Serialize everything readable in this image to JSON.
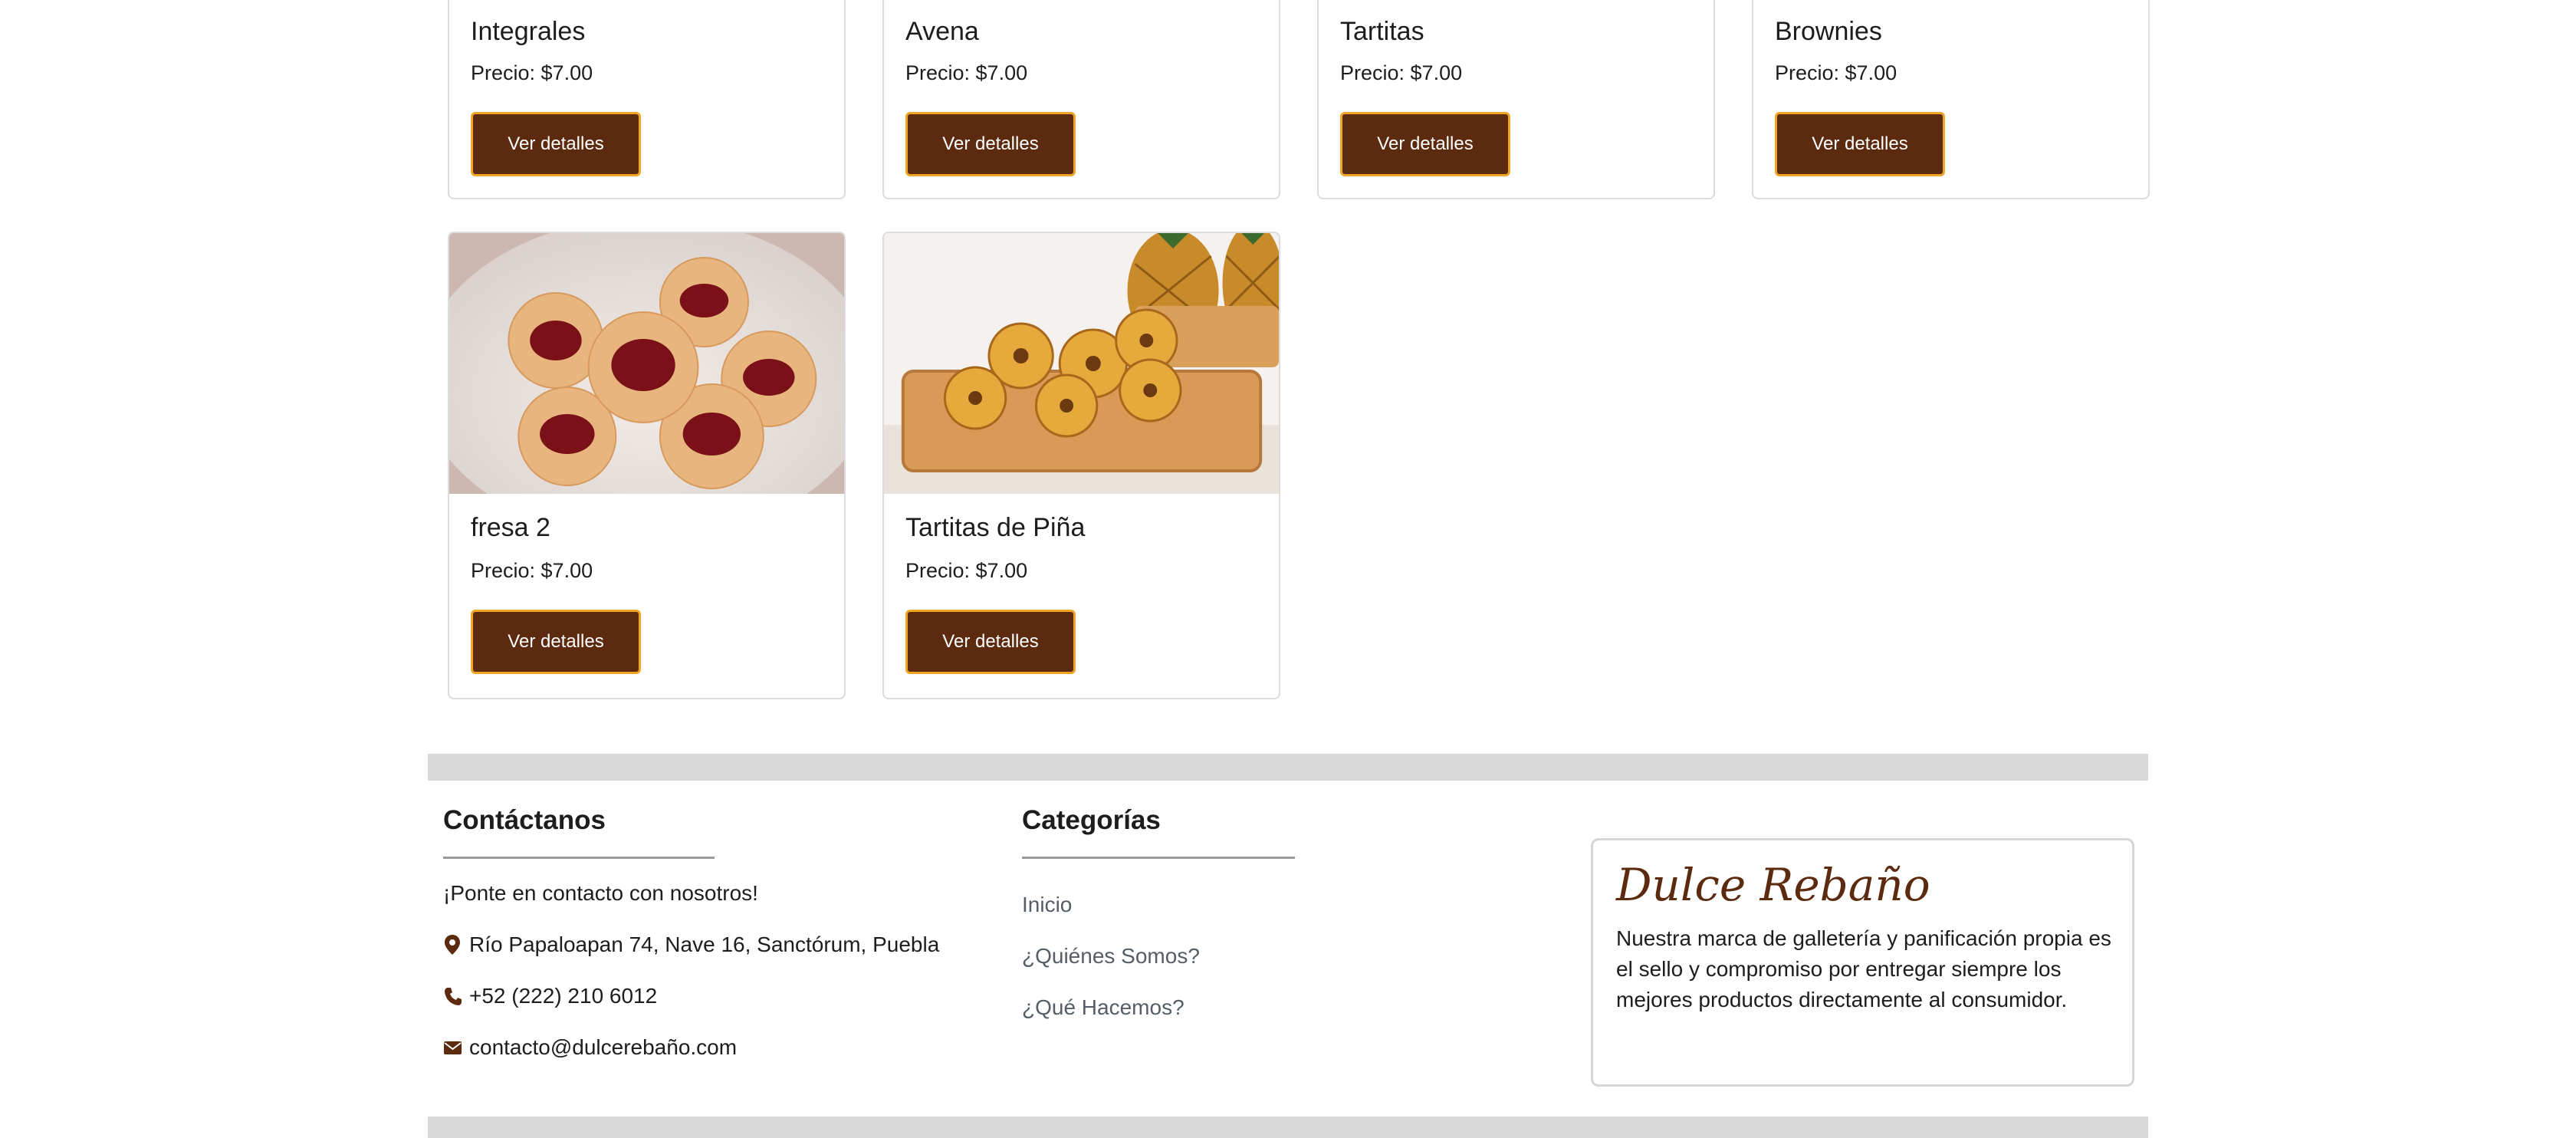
{
  "products": [
    {
      "name": "Integrales",
      "price": "Precio: $7.00",
      "button": "Ver detalles"
    },
    {
      "name": "Avena",
      "price": "Precio: $7.00",
      "button": "Ver detalles"
    },
    {
      "name": "Tartitas",
      "price": "Precio: $7.00",
      "button": "Ver detalles"
    },
    {
      "name": "Brownies",
      "price": "Precio: $7.00",
      "button": "Ver detalles"
    },
    {
      "name": "fresa 2",
      "price": "Precio: $7.00",
      "button": "Ver detalles"
    },
    {
      "name": "Tartitas de Piña",
      "price": "Precio: $7.00",
      "button": "Ver detalles"
    }
  ],
  "footer": {
    "contact": {
      "heading": "Contáctanos",
      "intro": "¡Ponte en contacto con nosotros!",
      "address": "Río Papaloapan 74, Nave 16, Sanctórum, Puebla",
      "phone": "+52 (222) 210 6012",
      "email": "contacto@dulcerebaño.com"
    },
    "categories": {
      "heading": "Categorías",
      "links": [
        "Inicio",
        "¿Quiénes Somos?",
        "¿Qué Hacemos?"
      ]
    },
    "brand": {
      "name": "Dulce Rebaño",
      "description": "Nuestra marca de galletería y panificación propia es el sello y compromiso por entregar siempre los mejores productos directamente al consumidor."
    }
  },
  "colors": {
    "accent": "#5c2b0f",
    "button_border": "#f0a623",
    "band": "#d9d9d9"
  }
}
